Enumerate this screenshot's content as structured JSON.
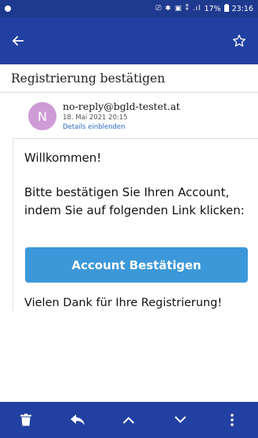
{
  "status_bar": {
    "right_icons_text": "⎚ ✱ ▣ ⁑ .ıl",
    "battery": "17%",
    "time": "23:16"
  },
  "app_bar": {
    "back_icon": "arrow-left-icon",
    "star_icon": "star-icon"
  },
  "subject": "Registrierung bestätigen",
  "sender": {
    "avatar_letter": "N",
    "avatar_color": "#cf9bd7",
    "email": "no-reply@bgld-testet.at",
    "date": "18. Mai 2021 20:15",
    "details_link": "Details einblenden"
  },
  "message": {
    "greeting": "Willkommen!",
    "instruction": "Bitte bestätigen Sie Ihren Account, indem Sie auf folgenden Link klicken:",
    "button_label": "Account Bestätigen",
    "button_color": "#3c98d8",
    "thanks": "Vielen Dank für Ihre Registrierung!"
  },
  "bottom_bar": {
    "icons": [
      "delete-icon",
      "reply-icon",
      "previous-icon",
      "next-icon",
      "more-icon"
    ]
  },
  "colors": {
    "primary": "#2140a1",
    "status_bar": "#1e3a8f"
  }
}
